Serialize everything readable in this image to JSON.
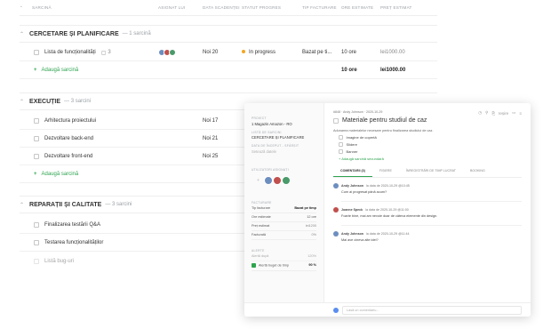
{
  "columns": {
    "task": "SARCINĂ",
    "assignee": "ASIGNAT LUI",
    "due": "DATA SCADENȚEI",
    "status": "STATUT PROGRES",
    "invoice": "TIP FACTURARE",
    "hours": "ORE ESTIMATE",
    "price": "PREȚ ESTIMAT"
  },
  "sections": [
    {
      "title": "CERCETARE ȘI PLANIFICARE",
      "count": "— 1 sarcină",
      "tasks": [
        {
          "name": "Lista de funcționalități",
          "files": "3",
          "due": "Noi 20",
          "status": "In progress",
          "invoice": "Bazat pe ti...",
          "hours": "10 ore",
          "price": "lei1000.00"
        }
      ],
      "add_label": "Adaugă sarcină",
      "total_hours": "10 ore",
      "total_price": "lei1000.00"
    },
    {
      "title": "EXECUȚIE",
      "count": "— 3 sarcini",
      "tasks": [
        {
          "name": "Arhitectura proiectului",
          "due": "Noi 17"
        },
        {
          "name": "Dezvoltare back-end",
          "due": "Noi 21"
        },
        {
          "name": "Dezvoltare front-end",
          "due": "Noi 25"
        }
      ],
      "add_label": "Adaugă sarcină"
    },
    {
      "title": "REPARAȚII ȘI CALITATE",
      "count": "— 3 sarcini",
      "tasks": [
        {
          "name": "Finalizarea testării Q&A"
        },
        {
          "name": "Testarea funcționalităților"
        },
        {
          "name": "Listă bug-uri"
        }
      ]
    }
  ],
  "panel": {
    "left": {
      "project_label": "PROIECT",
      "project": "1 Magazin Amazon - RO",
      "list_label": "LISTĂ DE SARCINI",
      "list": "CERCETARE ȘI PLANIFICARE",
      "start_label": "DATA DE ÎNCEPUT - SFÂRȘIT",
      "start": "Setează datele",
      "assigned_label": "UTILIZATORI ASIGNAȚI",
      "billing_label": "FACTURARE",
      "billing": [
        {
          "k": "Tip facturare",
          "v": "Bazat pe timp"
        },
        {
          "k": "Ore estimate",
          "v": "12 ore"
        },
        {
          "k": "Preț estimat",
          "v": "lei1200"
        },
        {
          "k": "Facturată",
          "v": "0%"
        }
      ],
      "alerts_label": "ALERTE",
      "alerts": [
        {
          "k": "Alertă după",
          "v": "120%"
        },
        {
          "k": "Alertă buget de timp",
          "v": "90 %"
        }
      ]
    },
    "right": {
      "meta": "#848 · Andy Johnson · 2020-10-29",
      "top_actions": "Ieșire",
      "title": "Materiale pentru studiul de caz",
      "description": "Adunarea materialelor necesare pentru finalizarea studiului de caz.",
      "subtasks": [
        "Imagine de copertă",
        "Slidere",
        "Banner"
      ],
      "add_subtask": "Adaugă sarcină secundară",
      "tabs": [
        "COMENTARII (3)",
        "FIȘIERE",
        "ÎNREGISTRĂRI DE TIMP LUCRAT",
        "BOOKING"
      ],
      "comments": [
        {
          "author": "Andy Johnson",
          "when": "la data de 2020-10-29 @10:45",
          "text": "Cum ai progresat până acum?"
        },
        {
          "author": "Joanne Speck",
          "when": "la data de 2020-10-29 @11:00",
          "text": "Foarte bine, mai am nevoie doar de câteva elemente din design."
        },
        {
          "author": "Andy Johnson",
          "when": "la data de 2020-10-29 @11:44",
          "text": "Mai ave cineva alte idei?"
        }
      ],
      "comment_placeholder": "Lasă un comentariu..."
    }
  },
  "colors": {
    "accent": "#2ea44f",
    "status_dot": "#f5a623",
    "avatar_a": "#6c8ebf",
    "avatar_b": "#c0504d",
    "avatar_c": "#4a9a6a"
  }
}
